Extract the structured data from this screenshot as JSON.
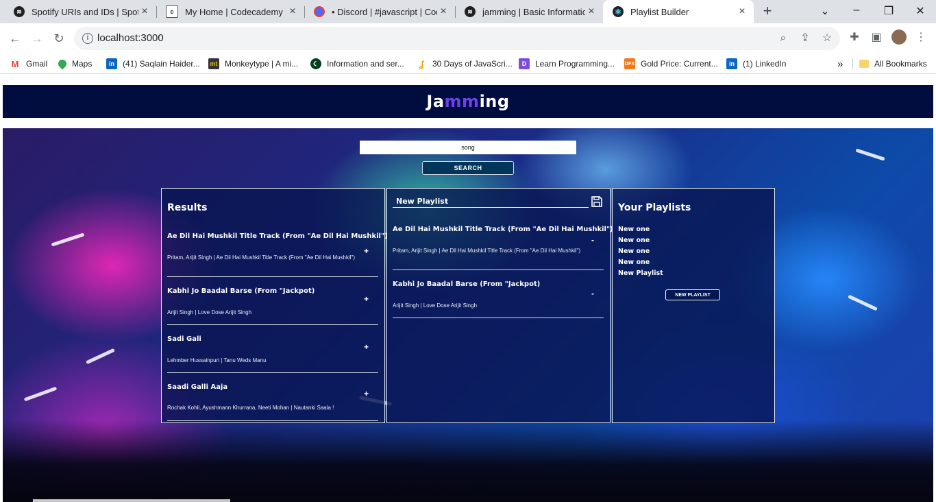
{
  "browser": {
    "tabs": [
      {
        "title": "Spotify URIs and IDs | Spotif",
        "icon": "spotify-icon",
        "active": false
      },
      {
        "title": "My Home | Codecademy",
        "icon": "codecademy-icon",
        "active": false
      },
      {
        "title": "• Discord | #javascript | Code",
        "icon": "discord-icon",
        "active": false
      },
      {
        "title": "jamming | Basic Information",
        "icon": "spotify-icon",
        "active": false
      },
      {
        "title": "Playlist Builder",
        "icon": "react-icon",
        "active": true
      }
    ],
    "url": "localhost:3000",
    "bookmarks": [
      {
        "label": "Gmail",
        "icon": "gmail-icon"
      },
      {
        "label": "Maps",
        "icon": "maps-icon"
      },
      {
        "label": "(41) Saqlain Haider...",
        "icon": "linkedin-icon"
      },
      {
        "label": "Monkeytype | A mi...",
        "icon": "monkeytype-icon"
      },
      {
        "label": "Information and ser...",
        "icon": "pakistan-flag-icon"
      },
      {
        "label": "30 Days of JavaScri...",
        "icon": "javascript-icon"
      },
      {
        "label": "Learn Programming...",
        "icon": "programming-icon"
      },
      {
        "label": "Gold Price: Current...",
        "icon": "dfx-icon"
      },
      {
        "label": "(1) LinkedIn",
        "icon": "linkedin-icon"
      }
    ],
    "bookmarks_overflow": "»",
    "all_bookmarks": "All Bookmarks"
  },
  "app": {
    "logo": {
      "part1": "Ja",
      "part2": "mm",
      "part3": "ing"
    },
    "search": {
      "value": "song",
      "button": "SEARCH"
    },
    "results": {
      "title": "Results",
      "tracks": [
        {
          "name": "Ae Dil Hai Mushkil Title Track (From \"Ae Dil Hai Mushkil\")",
          "info": "Pritam, Arijit Singh | Ae Dil Hai Mushkil Title Track (From \"Ae Dil Hai Mushkil\")",
          "action": "+"
        },
        {
          "name": "Kabhi Jo Baadal Barse (From \"Jackpot)",
          "info": "Arijit Singh | Love Dose Arijit Singh",
          "action": "+"
        },
        {
          "name": "Sadi Gali",
          "info": "Lehmber Hussainpuri | Tanu Weds Manu",
          "action": "+"
        },
        {
          "name": "Saadi Galli Aaja",
          "info": "Rochak Kohli, Ayushmann Khurrana, Neeti Mohan | Nautanki Saala !",
          "action": "+"
        }
      ]
    },
    "playlist": {
      "name": "New Playlist",
      "tracks": [
        {
          "name": "Ae Dil Hai Mushkil Title Track (From \"Ae Dil Hai Mushkil\")",
          "info": "Pritam, Arijit Singh | Ae Dil Hai Mushkil Title Track (From \"Ae Dil Hai Mushkil\")",
          "action": "-"
        },
        {
          "name": "Kabhi Jo Baadal Barse (From \"Jackpot)",
          "info": "Arijit Singh | Love Dose Arijit Singh",
          "action": "-"
        }
      ]
    },
    "your_playlists": {
      "title": "Your Playlists",
      "items": [
        "New one",
        "New one",
        "New one",
        "New one",
        "New Playlist"
      ],
      "button": "NEW PLAYLIST"
    }
  },
  "colors": {
    "header_bg": "#010c3f",
    "logo_accent": "#6c41ec",
    "search_button_bg": "#01365a"
  }
}
